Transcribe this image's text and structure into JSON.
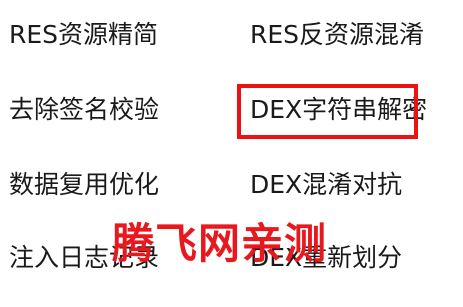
{
  "menu": {
    "items": [
      {
        "label": "RES资源精简"
      },
      {
        "label": "RES反资源混淆"
      },
      {
        "label": "去除签名校验"
      },
      {
        "label": "DEX字符串解密"
      },
      {
        "label": "数据复用优化"
      },
      {
        "label": "DEX混淆对抗"
      },
      {
        "label": "注入日志记录"
      },
      {
        "label": "DEX重新划分"
      }
    ],
    "highlighted_item": "DEX字符串解密"
  },
  "watermark": {
    "text": "腾飞网亲测",
    "color": "#e8191e"
  },
  "colors": {
    "text": "#1a1a1a",
    "highlight_border": "#ee1111",
    "background": "#ffffff"
  }
}
